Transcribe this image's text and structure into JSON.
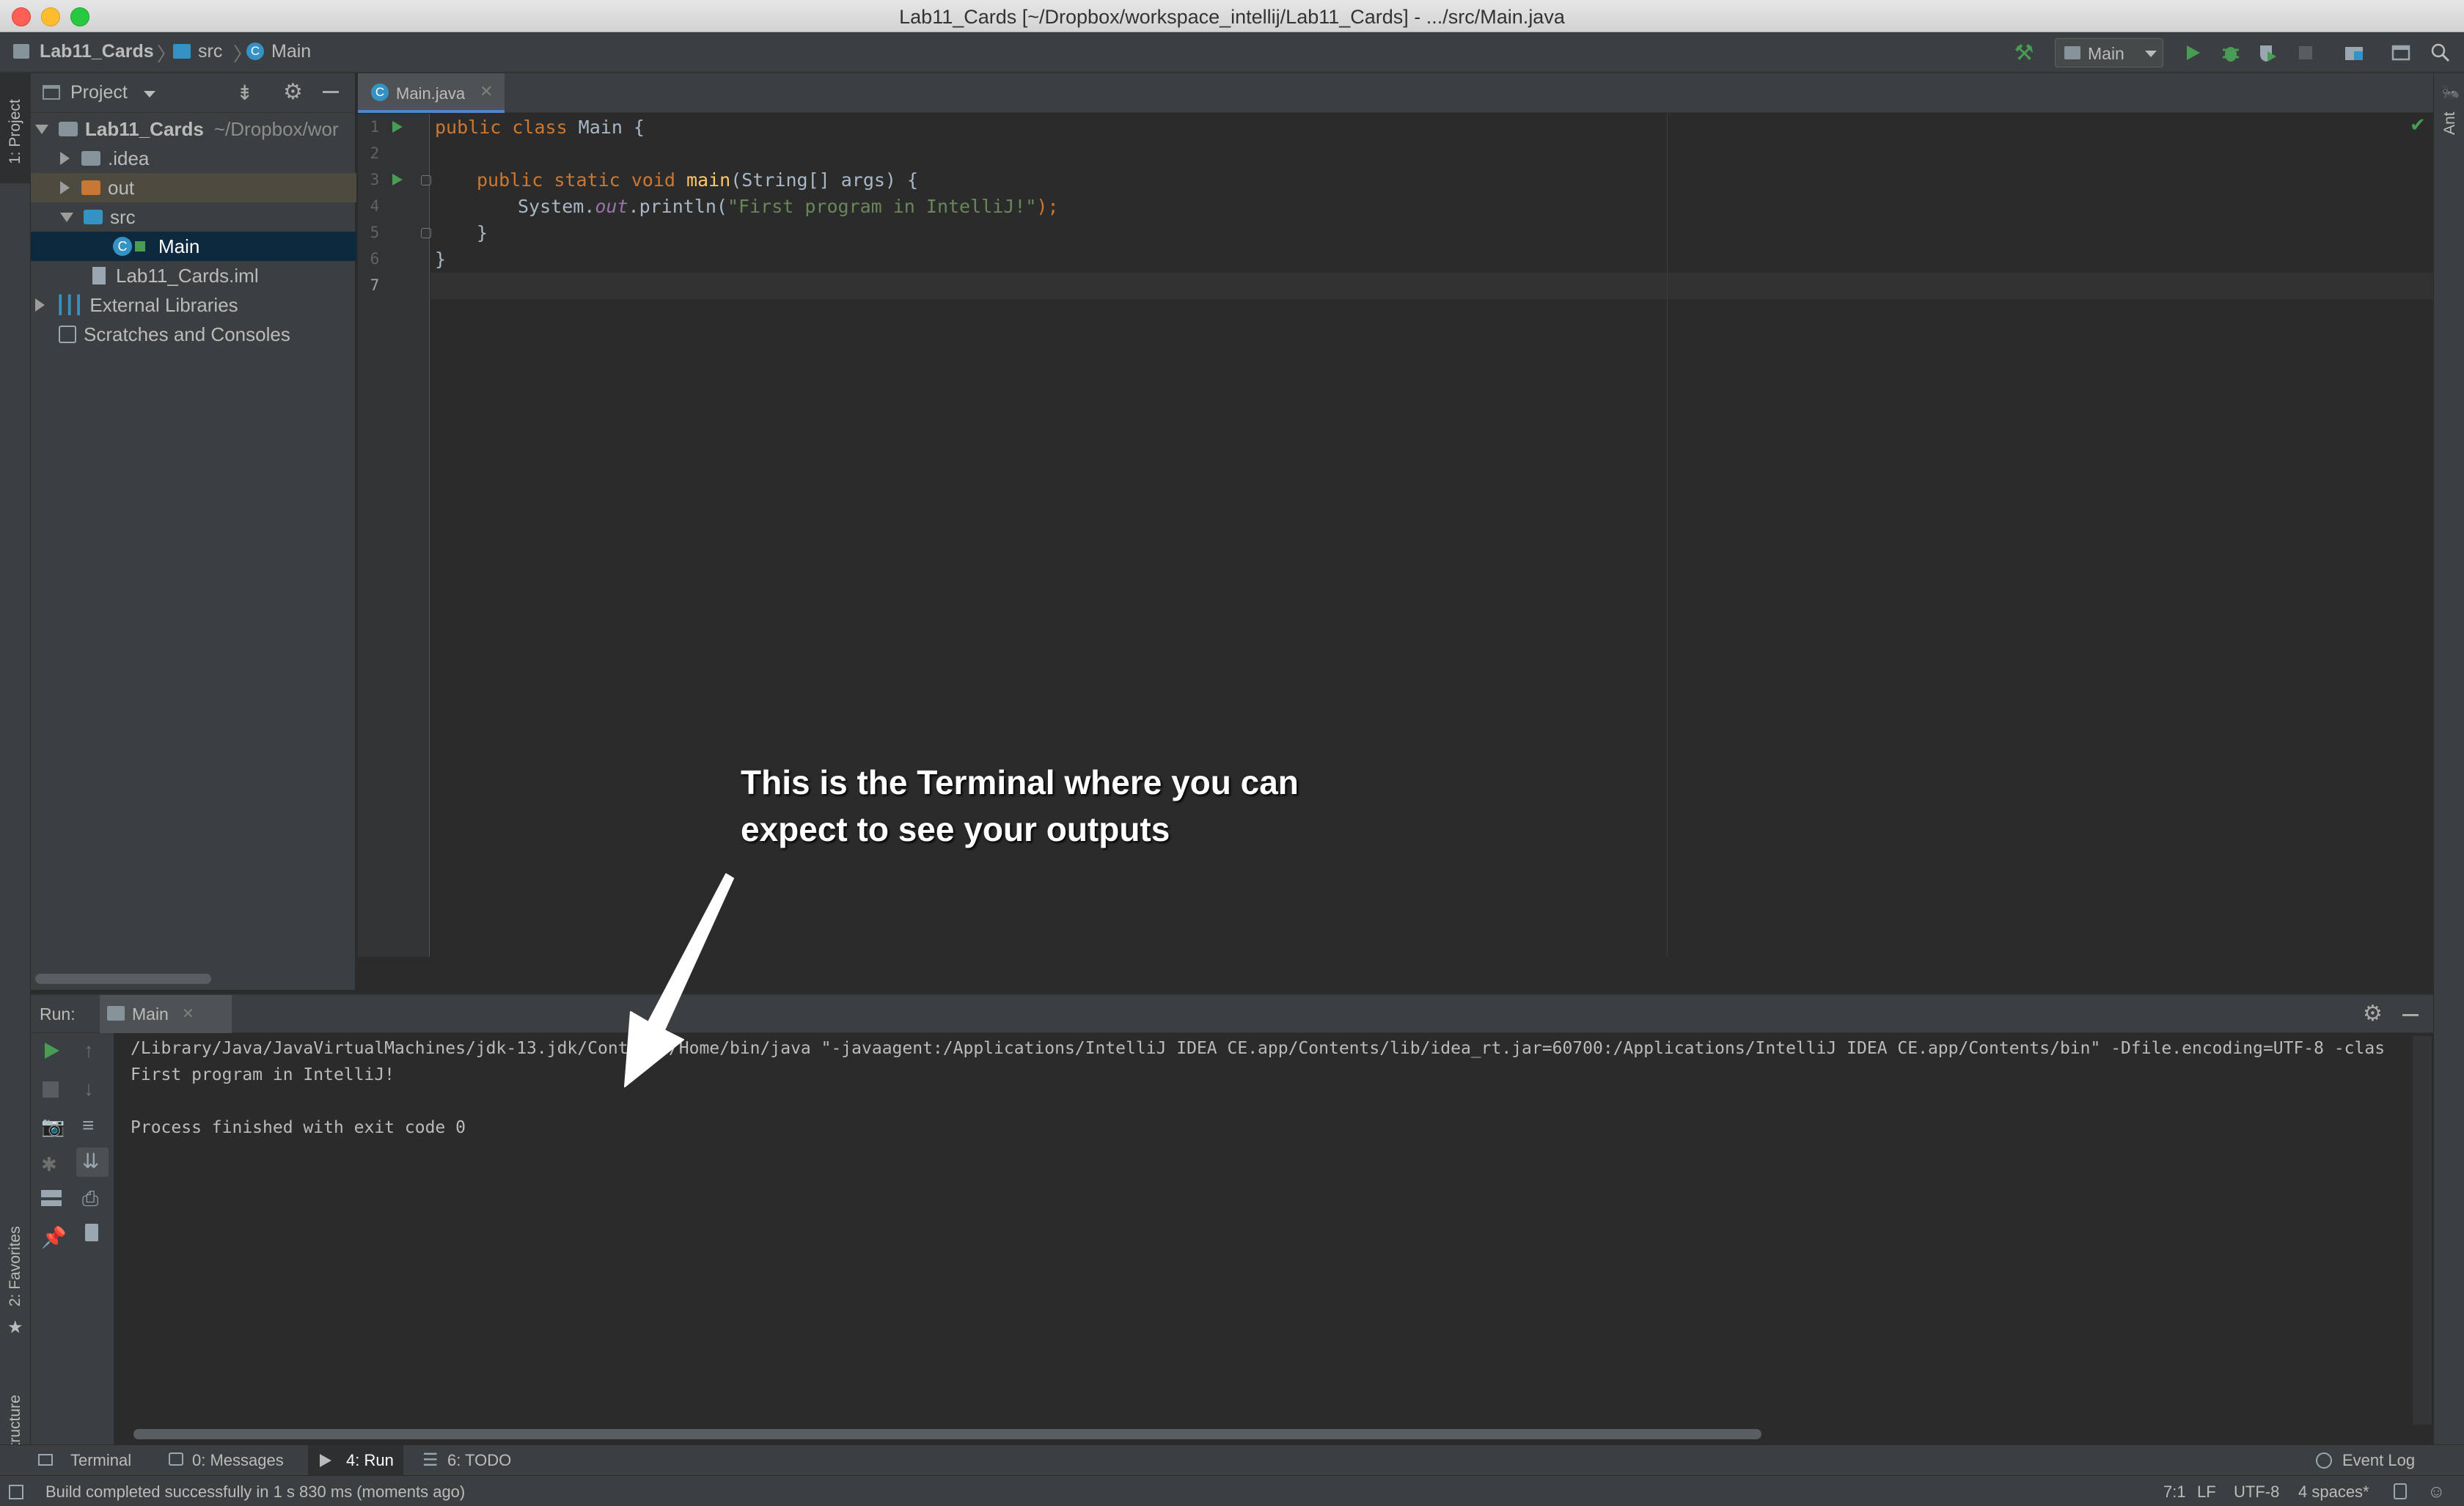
{
  "window": {
    "title": "Lab11_Cards [~/Dropbox/workspace_intellij/Lab11_Cards] - .../src/Main.java"
  },
  "breadcrumb": [
    "Lab11_Cards",
    "src",
    "Main"
  ],
  "toolbar": {
    "run_config": "Main"
  },
  "left_stripe": {
    "project_tab": "1: Project",
    "favorites_tab": "2: Favorites",
    "structure_tab": "Z: Structure"
  },
  "right_stripe": {
    "ant_tab": "Ant"
  },
  "project": {
    "header": "Project",
    "tree": [
      {
        "label": "Lab11_Cards",
        "hint": "~/Dropbox/wor"
      },
      {
        "label": ".idea"
      },
      {
        "label": "out"
      },
      {
        "label": "src"
      },
      {
        "label": "Main"
      },
      {
        "label": "Lab11_Cards.iml"
      },
      {
        "label": "External Libraries"
      },
      {
        "label": "Scratches and Consoles"
      }
    ]
  },
  "editor": {
    "tab": "Main.java",
    "line_numbers": [
      "1",
      "2",
      "3",
      "4",
      "5",
      "6",
      "7"
    ],
    "code": {
      "l1_kw": "public class ",
      "l1_name": "Main {",
      "l3_kw": "public static void ",
      "l3_fn": "main",
      "l3_rest": "(String[] args) {",
      "l4_a": "System.",
      "l4_out": "out",
      "l4_b": ".println(",
      "l4_str": "\"First program in IntelliJ!\"",
      "l4_c": ");",
      "l5": "}",
      "l6": "}"
    }
  },
  "run": {
    "label": "Run:",
    "tab": "Main",
    "console": [
      "/Library/Java/JavaVirtualMachines/jdk-13.jdk/Contents/Home/bin/java \"-javaagent:/Applications/IntelliJ IDEA CE.app/Contents/lib/idea_rt.jar=60700:/Applications/IntelliJ IDEA CE.app/Contents/bin\" -Dfile.encoding=UTF-8 -clas",
      "First program in IntelliJ!",
      "",
      "Process finished with exit code 0"
    ]
  },
  "annotation": {
    "line1": "This is the Terminal where you can",
    "line2": "expect to see your outputs"
  },
  "bottom_tabs": {
    "terminal": "Terminal",
    "messages": "0: Messages",
    "run": "4: Run",
    "todo": "6: TODO",
    "event_log": "Event Log"
  },
  "status": {
    "message": "Build completed successfully in 1 s 830 ms (moments ago)",
    "position": "7:1",
    "line_sep": "LF",
    "encoding": "UTF-8",
    "indent": "4 spaces*"
  },
  "colors": {
    "accent_green": "#499c54",
    "selection_blue": "#0d293e",
    "folder_blue": "#3592c4",
    "out_folder": "#c87832"
  }
}
